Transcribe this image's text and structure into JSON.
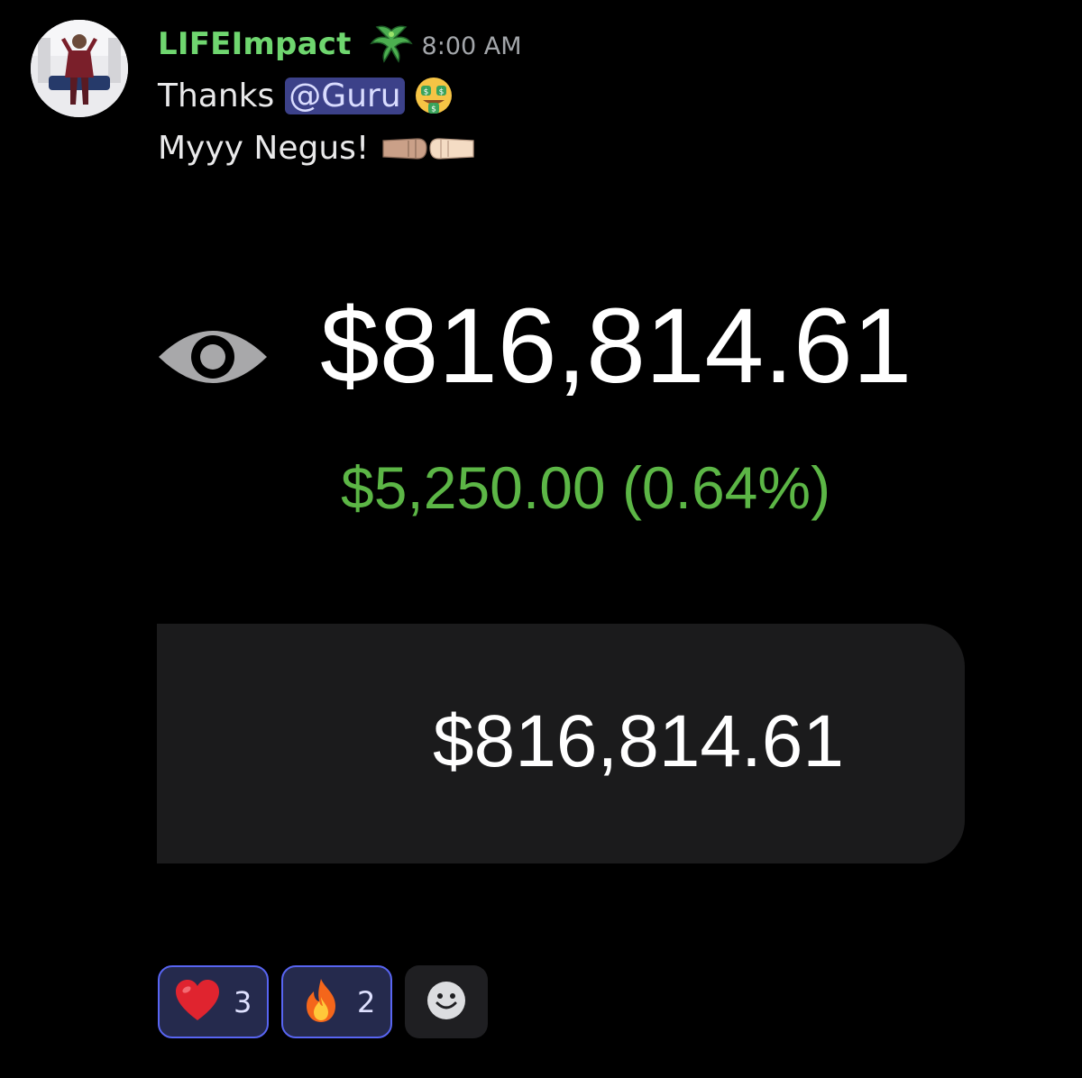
{
  "message": {
    "username": "LIFEImpact",
    "username_color": "#6fd66f",
    "role_icon": "phoenix-icon",
    "timestamp": "8:00 AM",
    "line1_text": "Thanks",
    "mention": "@Guru",
    "line1_emoji": "money-mouth-face-icon",
    "line2_text": "Myyy Negus!",
    "line2_emoji": "fist-bump-icon"
  },
  "attachment": {
    "visibility_icon": "eye-icon",
    "balance": "$816,814.61",
    "change": "$5,250.00 (0.64%)",
    "change_color": "#5cb646",
    "bubble_balance": "$816,814.61"
  },
  "reactions": [
    {
      "emoji": "heart-icon",
      "count": "3"
    },
    {
      "emoji": "fire-icon",
      "count": "2"
    }
  ],
  "add_reaction_icon": "smiley-add-reaction-icon"
}
